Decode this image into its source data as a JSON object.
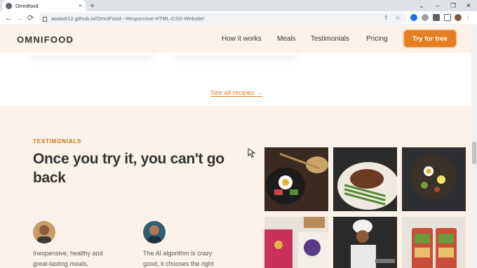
{
  "browser": {
    "tab_title": "Omnifood",
    "tab_close": "×",
    "new_tab": "+",
    "url": "awais612.github.io/OmniFood---Responsive-HTML-CSS-Website/",
    "window_controls": [
      "⌄",
      "–",
      "❐",
      "✕"
    ],
    "nav": {
      "back": "←",
      "forward": "→",
      "reload": "⟳"
    },
    "omnibox_icons": {
      "share": "⇪",
      "star": "☆"
    },
    "menu": "⋮"
  },
  "header": {
    "logo": "OMNIFOOD",
    "nav": [
      "How it works",
      "Meals",
      "Testimonials",
      "Pricing"
    ],
    "cta": "Try for free"
  },
  "meals": {
    "see_all": "See all recipes →"
  },
  "testimonials": {
    "subheading": "TESTIMONIALS",
    "heading": "Once you try it, you can't go back",
    "items": [
      {
        "quote": "Inexpensive, healthy and great-tasting meals,"
      },
      {
        "quote": "The AI algorithm is crazy good, it chooses the right"
      }
    ]
  },
  "gallery": {
    "images": [
      "bibimbap-bowl",
      "steak-with-asparagus",
      "grain-bowl-with-eggs",
      "fruit-and-yogurt-bowls",
      "chef-cooking",
      "meal-prep-containers"
    ]
  },
  "colors": {
    "accent": "#e67e22",
    "accent_dark": "#cf711f",
    "section_bg": "#fdf2e9",
    "text": "#333333"
  }
}
